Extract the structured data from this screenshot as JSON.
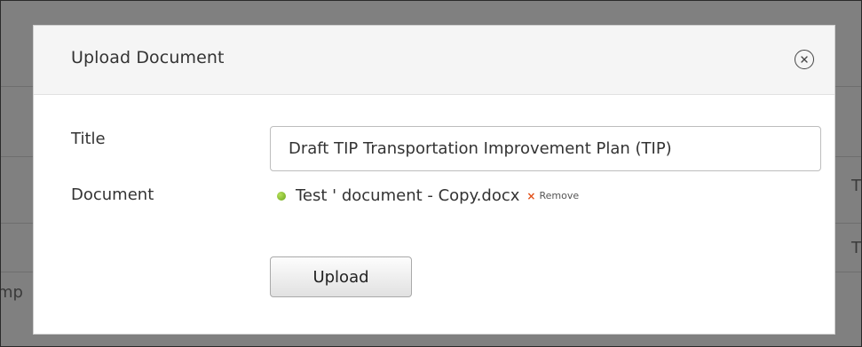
{
  "modal": {
    "title": "Upload Document",
    "close_icon": "close-circle-icon",
    "fields": {
      "title_label": "Title",
      "title_value": "Draft TIP Transportation Improvement Plan (TIP)",
      "document_label": "Document"
    },
    "file": {
      "name": "Test ' document - Copy.docx",
      "status_color": "#7ab829",
      "remove_icon": "×",
      "remove_label": "Remove"
    },
    "upload_label": "Upload"
  },
  "background": {
    "left_fragment": "mp",
    "right_fragment_1": "T",
    "right_fragment_2": "T"
  },
  "colors": {
    "overlay": "#808080",
    "header_bg": "#f5f5f5",
    "remove_x": "#e2531c"
  }
}
